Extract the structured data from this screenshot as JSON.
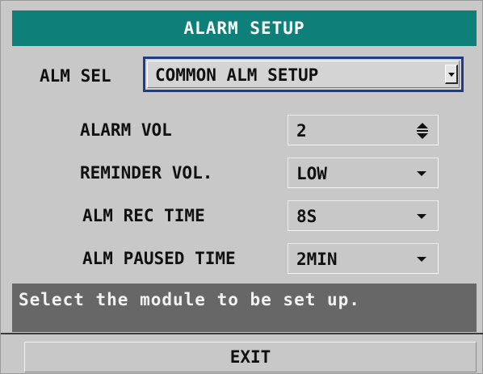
{
  "dialog": {
    "title": "ALARM SETUP",
    "colors": {
      "title_bar": "#0f7f7a",
      "background": "#c8c8c8",
      "help_panel": "#676767",
      "focus_border": "#1d3d8a"
    }
  },
  "alm_sel": {
    "label": "ALM SEL",
    "value": "COMMON ALM SETUP",
    "control": "dropdown"
  },
  "settings": [
    {
      "label": "ALARM VOL",
      "value": "2",
      "control": "stepper",
      "icon": "up-down-arrow-icon"
    },
    {
      "label": "REMINDER VOL.",
      "value": "LOW",
      "control": "dropdown",
      "icon": "chevron-down-icon"
    },
    {
      "label": "ALM REC TIME",
      "value": "8S",
      "control": "dropdown",
      "icon": "chevron-down-icon"
    },
    {
      "label": "ALM PAUSED TIME",
      "value": "2MIN",
      "control": "dropdown",
      "icon": "chevron-down-icon"
    }
  ],
  "help": {
    "text": "Select the module to be set up."
  },
  "footer": {
    "exit_label": "EXIT"
  }
}
